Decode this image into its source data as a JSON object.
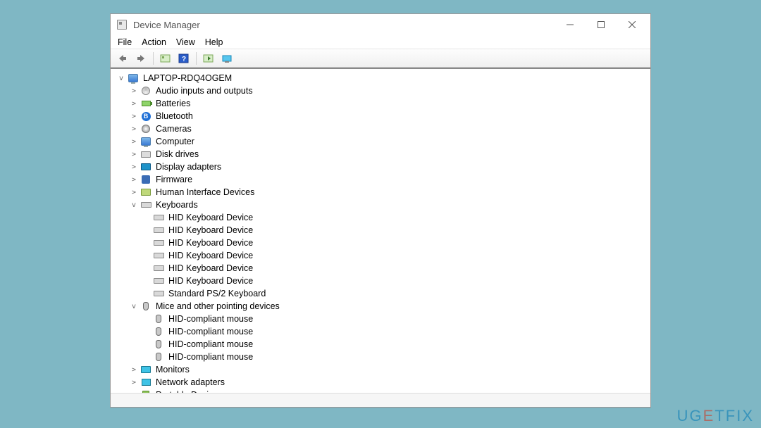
{
  "window": {
    "title": "Device Manager"
  },
  "menubar": {
    "file": "File",
    "action": "Action",
    "view": "View",
    "help": "Help"
  },
  "tree": {
    "root": {
      "label": "LAPTOP-RDQ4OGEM",
      "expanded": true
    },
    "categories": [
      {
        "label": "Audio inputs and outputs",
        "icon": "speaker",
        "expanded": false
      },
      {
        "label": "Batteries",
        "icon": "battery",
        "expanded": false
      },
      {
        "label": "Bluetooth",
        "icon": "bluetooth",
        "expanded": false
      },
      {
        "label": "Cameras",
        "icon": "camera",
        "expanded": false
      },
      {
        "label": "Computer",
        "icon": "computer",
        "expanded": false
      },
      {
        "label": "Disk drives",
        "icon": "disk",
        "expanded": false
      },
      {
        "label": "Display adapters",
        "icon": "display",
        "expanded": false
      },
      {
        "label": "Firmware",
        "icon": "firmware",
        "expanded": false
      },
      {
        "label": "Human Interface Devices",
        "icon": "hid",
        "expanded": false
      },
      {
        "label": "Keyboards",
        "icon": "keyboard",
        "expanded": true,
        "children": [
          {
            "label": "HID Keyboard Device",
            "icon": "keyboard"
          },
          {
            "label": "HID Keyboard Device",
            "icon": "keyboard"
          },
          {
            "label": "HID Keyboard Device",
            "icon": "keyboard"
          },
          {
            "label": "HID Keyboard Device",
            "icon": "keyboard"
          },
          {
            "label": "HID Keyboard Device",
            "icon": "keyboard"
          },
          {
            "label": "HID Keyboard Device",
            "icon": "keyboard"
          },
          {
            "label": "Standard PS/2 Keyboard",
            "icon": "keyboard"
          }
        ]
      },
      {
        "label": "Mice and other pointing devices",
        "icon": "mouse",
        "expanded": true,
        "children": [
          {
            "label": "HID-compliant mouse",
            "icon": "mouse"
          },
          {
            "label": "HID-compliant mouse",
            "icon": "mouse"
          },
          {
            "label": "HID-compliant mouse",
            "icon": "mouse"
          },
          {
            "label": "HID-compliant mouse",
            "icon": "mouse"
          }
        ]
      },
      {
        "label": "Monitors",
        "icon": "monitor",
        "expanded": false
      },
      {
        "label": "Network adapters",
        "icon": "network",
        "expanded": false
      },
      {
        "label": "Portable Devices",
        "icon": "portable",
        "expanded": false
      }
    ]
  },
  "watermark": {
    "pre": "UG",
    "mid": "E",
    "post": "TFIX"
  }
}
